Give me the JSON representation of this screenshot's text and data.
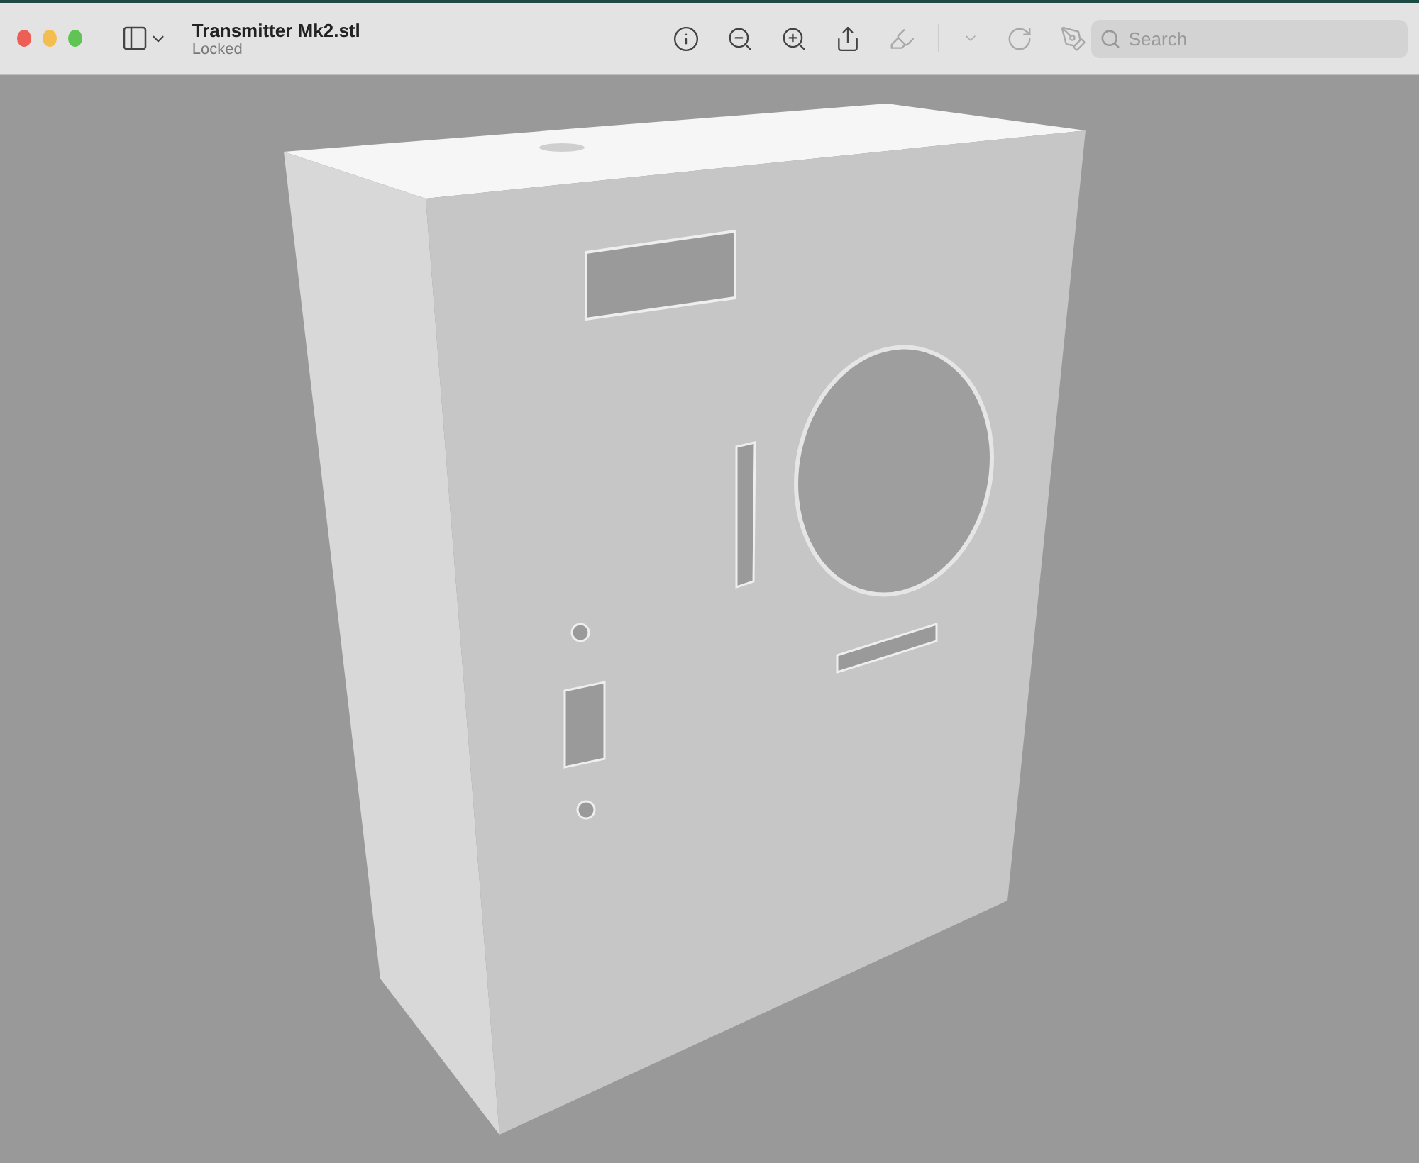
{
  "window": {
    "title": "Transmitter Mk2.stl",
    "subtitle": "Locked"
  },
  "toolbar": [
    {
      "kind": "info",
      "disabled": false
    },
    {
      "kind": "zoom-out",
      "disabled": false
    },
    {
      "kind": "zoom-in",
      "disabled": false
    },
    {
      "kind": "share",
      "disabled": false
    },
    {
      "kind": "highlight",
      "disabled": true
    },
    {
      "kind": "menu",
      "disabled": true
    },
    {
      "kind": "rotate",
      "disabled": true
    },
    {
      "kind": "markup",
      "disabled": true
    }
  ],
  "search": {
    "placeholder": "Search"
  }
}
